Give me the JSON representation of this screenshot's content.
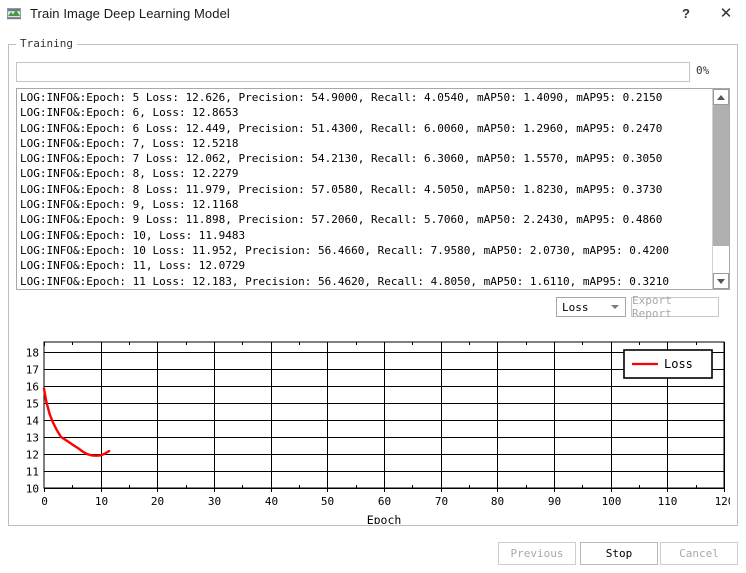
{
  "window": {
    "title": "Train Image Deep Learning Model",
    "icon": "app-icon",
    "help_label": "?",
    "close_label": "✕"
  },
  "group": {
    "legend": "Training"
  },
  "progress": {
    "percent": 0,
    "percent_label": "0%"
  },
  "log": {
    "lines": [
      "LOG:INFO&:Epoch: 5 Loss: 12.626, Precision: 54.9000, Recall: 4.0540, mAP50: 1.4090, mAP95: 0.2150",
      "LOG:INFO&:Epoch: 6, Loss: 12.8653",
      "LOG:INFO&:Epoch: 6 Loss: 12.449, Precision: 51.4300, Recall: 6.0060, mAP50: 1.2960, mAP95: 0.2470",
      "LOG:INFO&:Epoch: 7, Loss: 12.5218",
      "LOG:INFO&:Epoch: 7 Loss: 12.062, Precision: 54.2130, Recall: 6.3060, mAP50: 1.5570, mAP95: 0.3050",
      "LOG:INFO&:Epoch: 8, Loss: 12.2279",
      "LOG:INFO&:Epoch: 8 Loss: 11.979, Precision: 57.0580, Recall: 4.5050, mAP50: 1.8230, mAP95: 0.3730",
      "LOG:INFO&:Epoch: 9, Loss: 12.1168",
      "LOG:INFO&:Epoch: 9 Loss: 11.898, Precision: 57.2060, Recall: 5.7060, mAP50: 2.2430, mAP95: 0.4860",
      "LOG:INFO&:Epoch: 10, Loss: 11.9483",
      "LOG:INFO&:Epoch: 10 Loss: 11.952, Precision: 56.4660, Recall: 7.9580, mAP50: 2.0730, mAP95: 0.4200",
      "LOG:INFO&:Epoch: 11, Loss: 12.0729",
      "LOG:INFO&:Epoch: 11 Loss: 12.183, Precision: 56.4620, Recall: 4.8050, mAP50: 1.6110, mAP95: 0.3210"
    ]
  },
  "controls": {
    "metric_selected": "Loss",
    "metric_options": [
      "Loss"
    ],
    "export_label": "Export Report"
  },
  "buttons": {
    "previous": "Previous",
    "stop": "Stop",
    "cancel": "Cancel"
  },
  "chart_data": {
    "type": "line",
    "title": "",
    "xlabel": "Epoch",
    "ylabel": "",
    "xlim": [
      0,
      120
    ],
    "ylim": [
      10,
      18.6
    ],
    "xticks": [
      0,
      10,
      20,
      30,
      40,
      50,
      60,
      70,
      80,
      90,
      100,
      110,
      120
    ],
    "yticks": [
      10,
      11,
      12,
      13,
      14,
      15,
      16,
      17,
      18
    ],
    "grid": true,
    "legend": "upper right",
    "series": [
      {
        "name": "Loss",
        "color": "#ff0000",
        "x": [
          0,
          0.4,
          1,
          1.6,
          2.2,
          3,
          3.6,
          4.4,
          5.2,
          6,
          6.8,
          7.6,
          8.4,
          9.2,
          10,
          10.6,
          11.2,
          11.5
        ],
        "y": [
          15.85,
          15.1,
          14.35,
          13.85,
          13.45,
          13.0,
          12.88,
          12.7,
          12.52,
          12.35,
          12.15,
          12.0,
          11.92,
          11.9,
          11.92,
          12.0,
          12.12,
          12.18
        ]
      }
    ]
  }
}
